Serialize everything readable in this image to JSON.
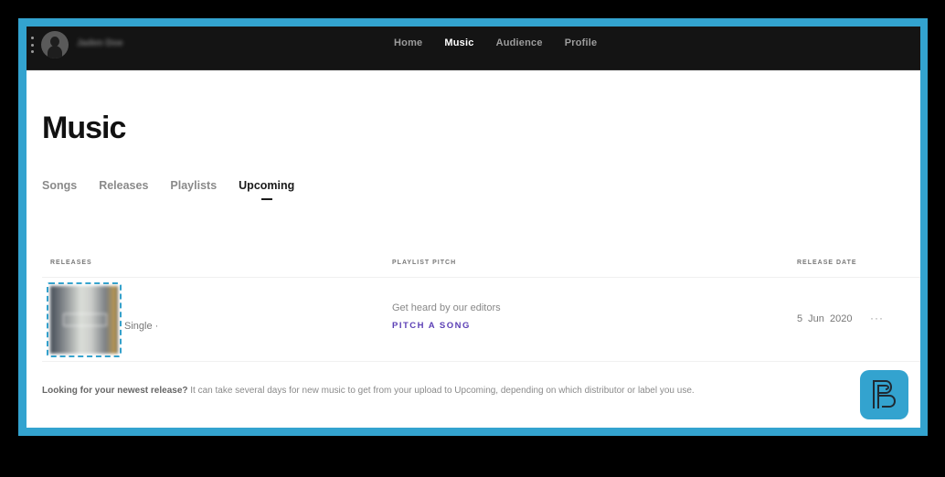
{
  "topbar": {
    "user_name": "Jaden Doe",
    "nav": [
      {
        "label": "Home",
        "active": false
      },
      {
        "label": "Music",
        "active": true
      },
      {
        "label": "Audience",
        "active": false
      },
      {
        "label": "Profile",
        "active": false
      }
    ]
  },
  "page": {
    "title": "Music",
    "tabs": [
      {
        "label": "Songs",
        "active": false
      },
      {
        "label": "Releases",
        "active": false
      },
      {
        "label": "Playlists",
        "active": false
      },
      {
        "label": "Upcoming",
        "active": true
      }
    ]
  },
  "table": {
    "columns": {
      "releases": "RELEASES",
      "playlist_pitch": "PLAYLIST PITCH",
      "release_date": "RELEASE DATE"
    },
    "rows": [
      {
        "release_type": "Single ·",
        "pitch_description": "Get heard by our editors",
        "pitch_action": "PITCH A SONG",
        "release_date": "5 Jun 2020",
        "more_label": "···"
      }
    ]
  },
  "footer": {
    "note_bold": "Looking for your newest release?",
    "note_text": " It can take several days for new music to get from your upload to Upcoming, depending on which distributor or label you use."
  },
  "colors": {
    "frame_accent": "#33a3cf",
    "pitch_link": "#5b3fb5",
    "topbar_bg": "#141414"
  }
}
